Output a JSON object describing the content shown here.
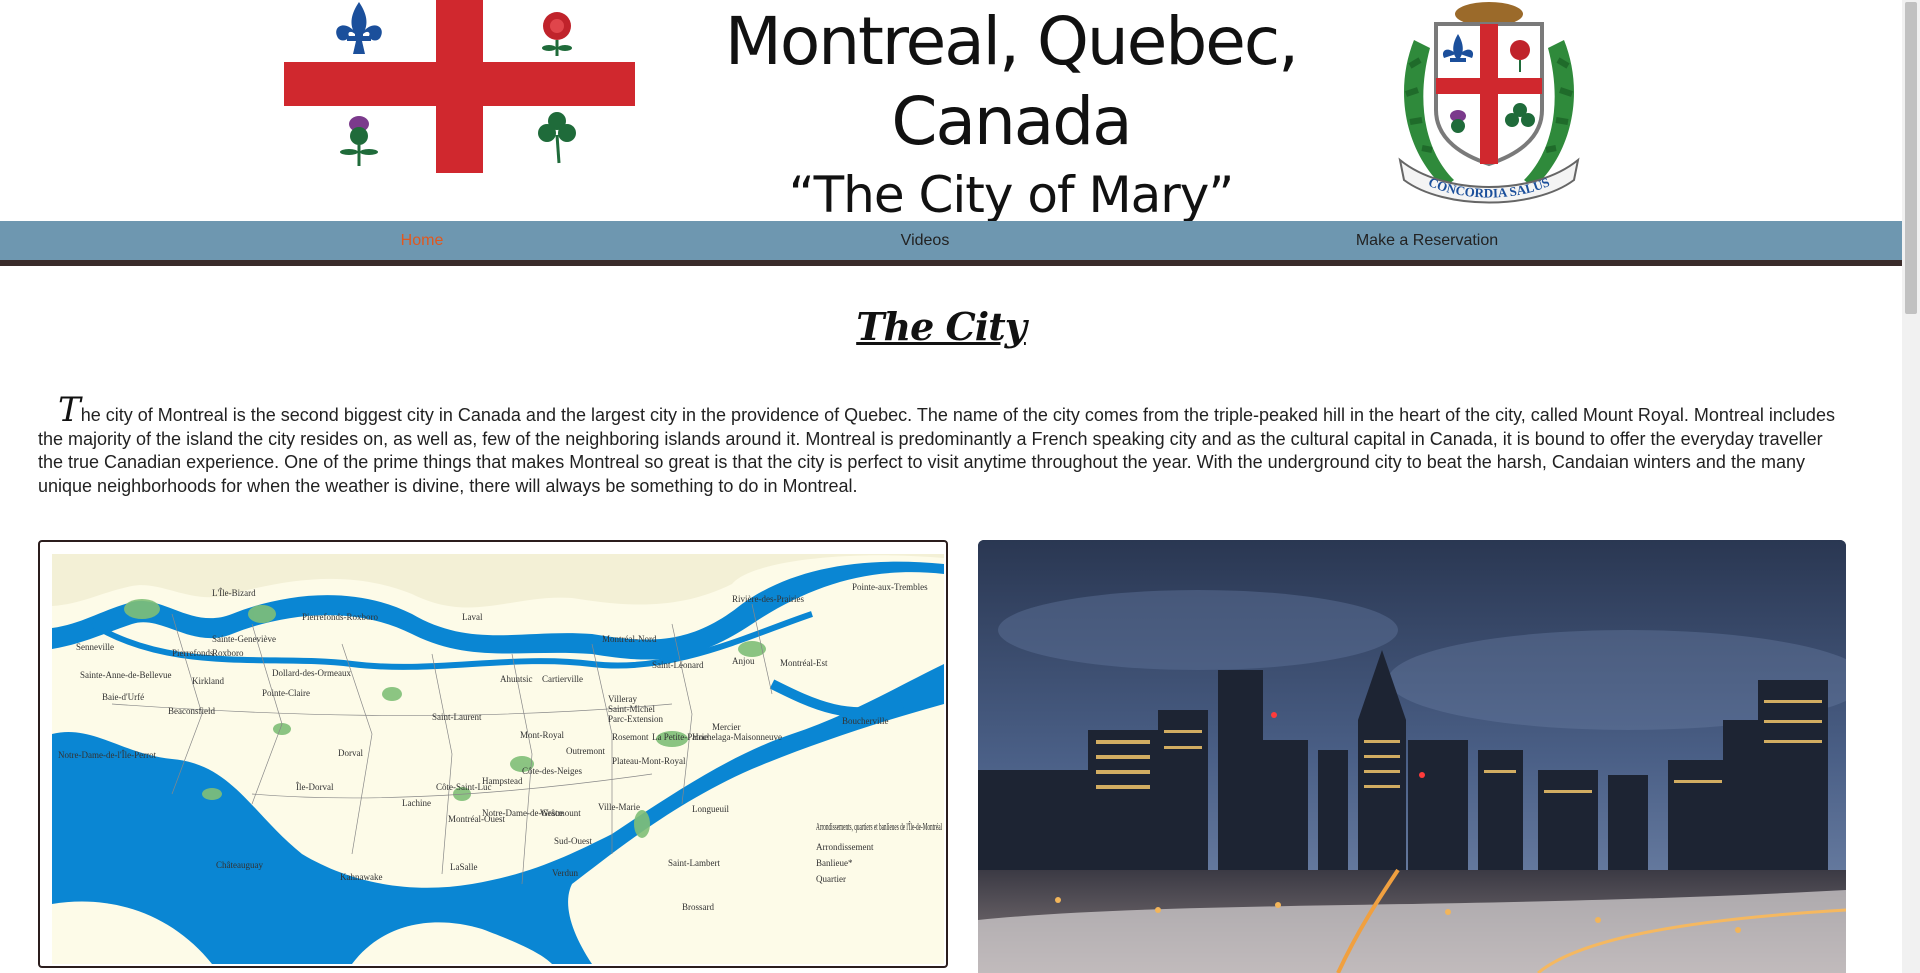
{
  "header": {
    "title": "Montreal, Quebec, Canada",
    "subtitle": "“The City of Mary”",
    "coat_motto": "CONCORDIA SALUS"
  },
  "nav": {
    "items": [
      {
        "label": "Home",
        "active": true
      },
      {
        "label": "Videos",
        "active": false
      },
      {
        "label": "Make a Reservation",
        "active": false
      }
    ]
  },
  "main": {
    "section_title": "The City",
    "intro_dropcap": "T",
    "intro_text": "he city of Montreal is the second biggest city in Canada and the largest city in the providence of Quebec. The name of the city comes from the triple-peaked hill in the heart of the city, called Mount Royal. Montreal includes the majority of the island the city resides on, as well as, few of the neighboring islands around it. Montreal is predominantly a French speaking city and as the cultural capital in Canada, it is bound to offer the everyday traveller the true Canadian experience. One of the prime things that makes Montreal so great is that the city is perfect to visit anytime throughout the year. With the underground city to beat the harsh, Candaian winters and the many unique neighborhoods for when the weather is divine, there will always be something to do in Montreal."
  },
  "map": {
    "labels": [
      "L'Île-Bizard",
      "Pierrefonds-Roxboro",
      "Laval",
      "Rivière-des-Prairies",
      "Pointe-aux-Trembles",
      "Senneville",
      "Sainte-Geneviève",
      "Pierrefonds",
      "Roxboro",
      "Montréal-Nord",
      "Sainte-Anne-de-Bellevue",
      "Dollard-des-Ormeaux",
      "Saint-Léonard",
      "Anjou",
      "Montréal-Est",
      "Kirkland",
      "Pointe-Claire",
      "Ahuntsic",
      "Cartierville",
      "Baie-d'Urfé",
      "Beaconsfield",
      "Saint-Laurent",
      "Villeray",
      "Saint-Michel",
      "Parc-Extension",
      "Boucherville",
      "Mont-Royal",
      "Rosemont",
      "La Petite-Patrie",
      "Mercier",
      "Hochelaga-Maisonneuve",
      "Notre-Dame-de-l'Île-Perrot",
      "Dorval",
      "Outremont",
      "Plateau-Mont-Royal",
      "Côte-des-Neiges",
      "Hampstead",
      "Côte-Saint-Luc",
      "Île-Dorval",
      "Lachine",
      "Montréal-Ouest",
      "Notre-Dame-de-Grâce",
      "Westmount",
      "Ville-Marie",
      "Longueuil",
      "Sud-Ouest",
      "Châteauguay",
      "Kahnawake",
      "LaSalle",
      "Verdun",
      "Saint-Lambert",
      "Brossard"
    ],
    "legend_title": "Arrondissements, quartiers et banlieues de l'Île-de-Montréal",
    "legend_items": [
      "Arrondissement",
      "Banlieue*",
      "Quartier"
    ]
  },
  "colors": {
    "nav_bg": "#6e97b0",
    "nav_border": "#3a2b2a",
    "nav_active": "#e0581f",
    "flag_red": "#d0282e",
    "flag_blue": "#1b4f9b",
    "water": "#0a86d3",
    "land": "#fdfbe8",
    "park": "#7fbf77"
  },
  "icons": {
    "flag": "montreal-flag",
    "coat": "montreal-coat-of-arms"
  }
}
